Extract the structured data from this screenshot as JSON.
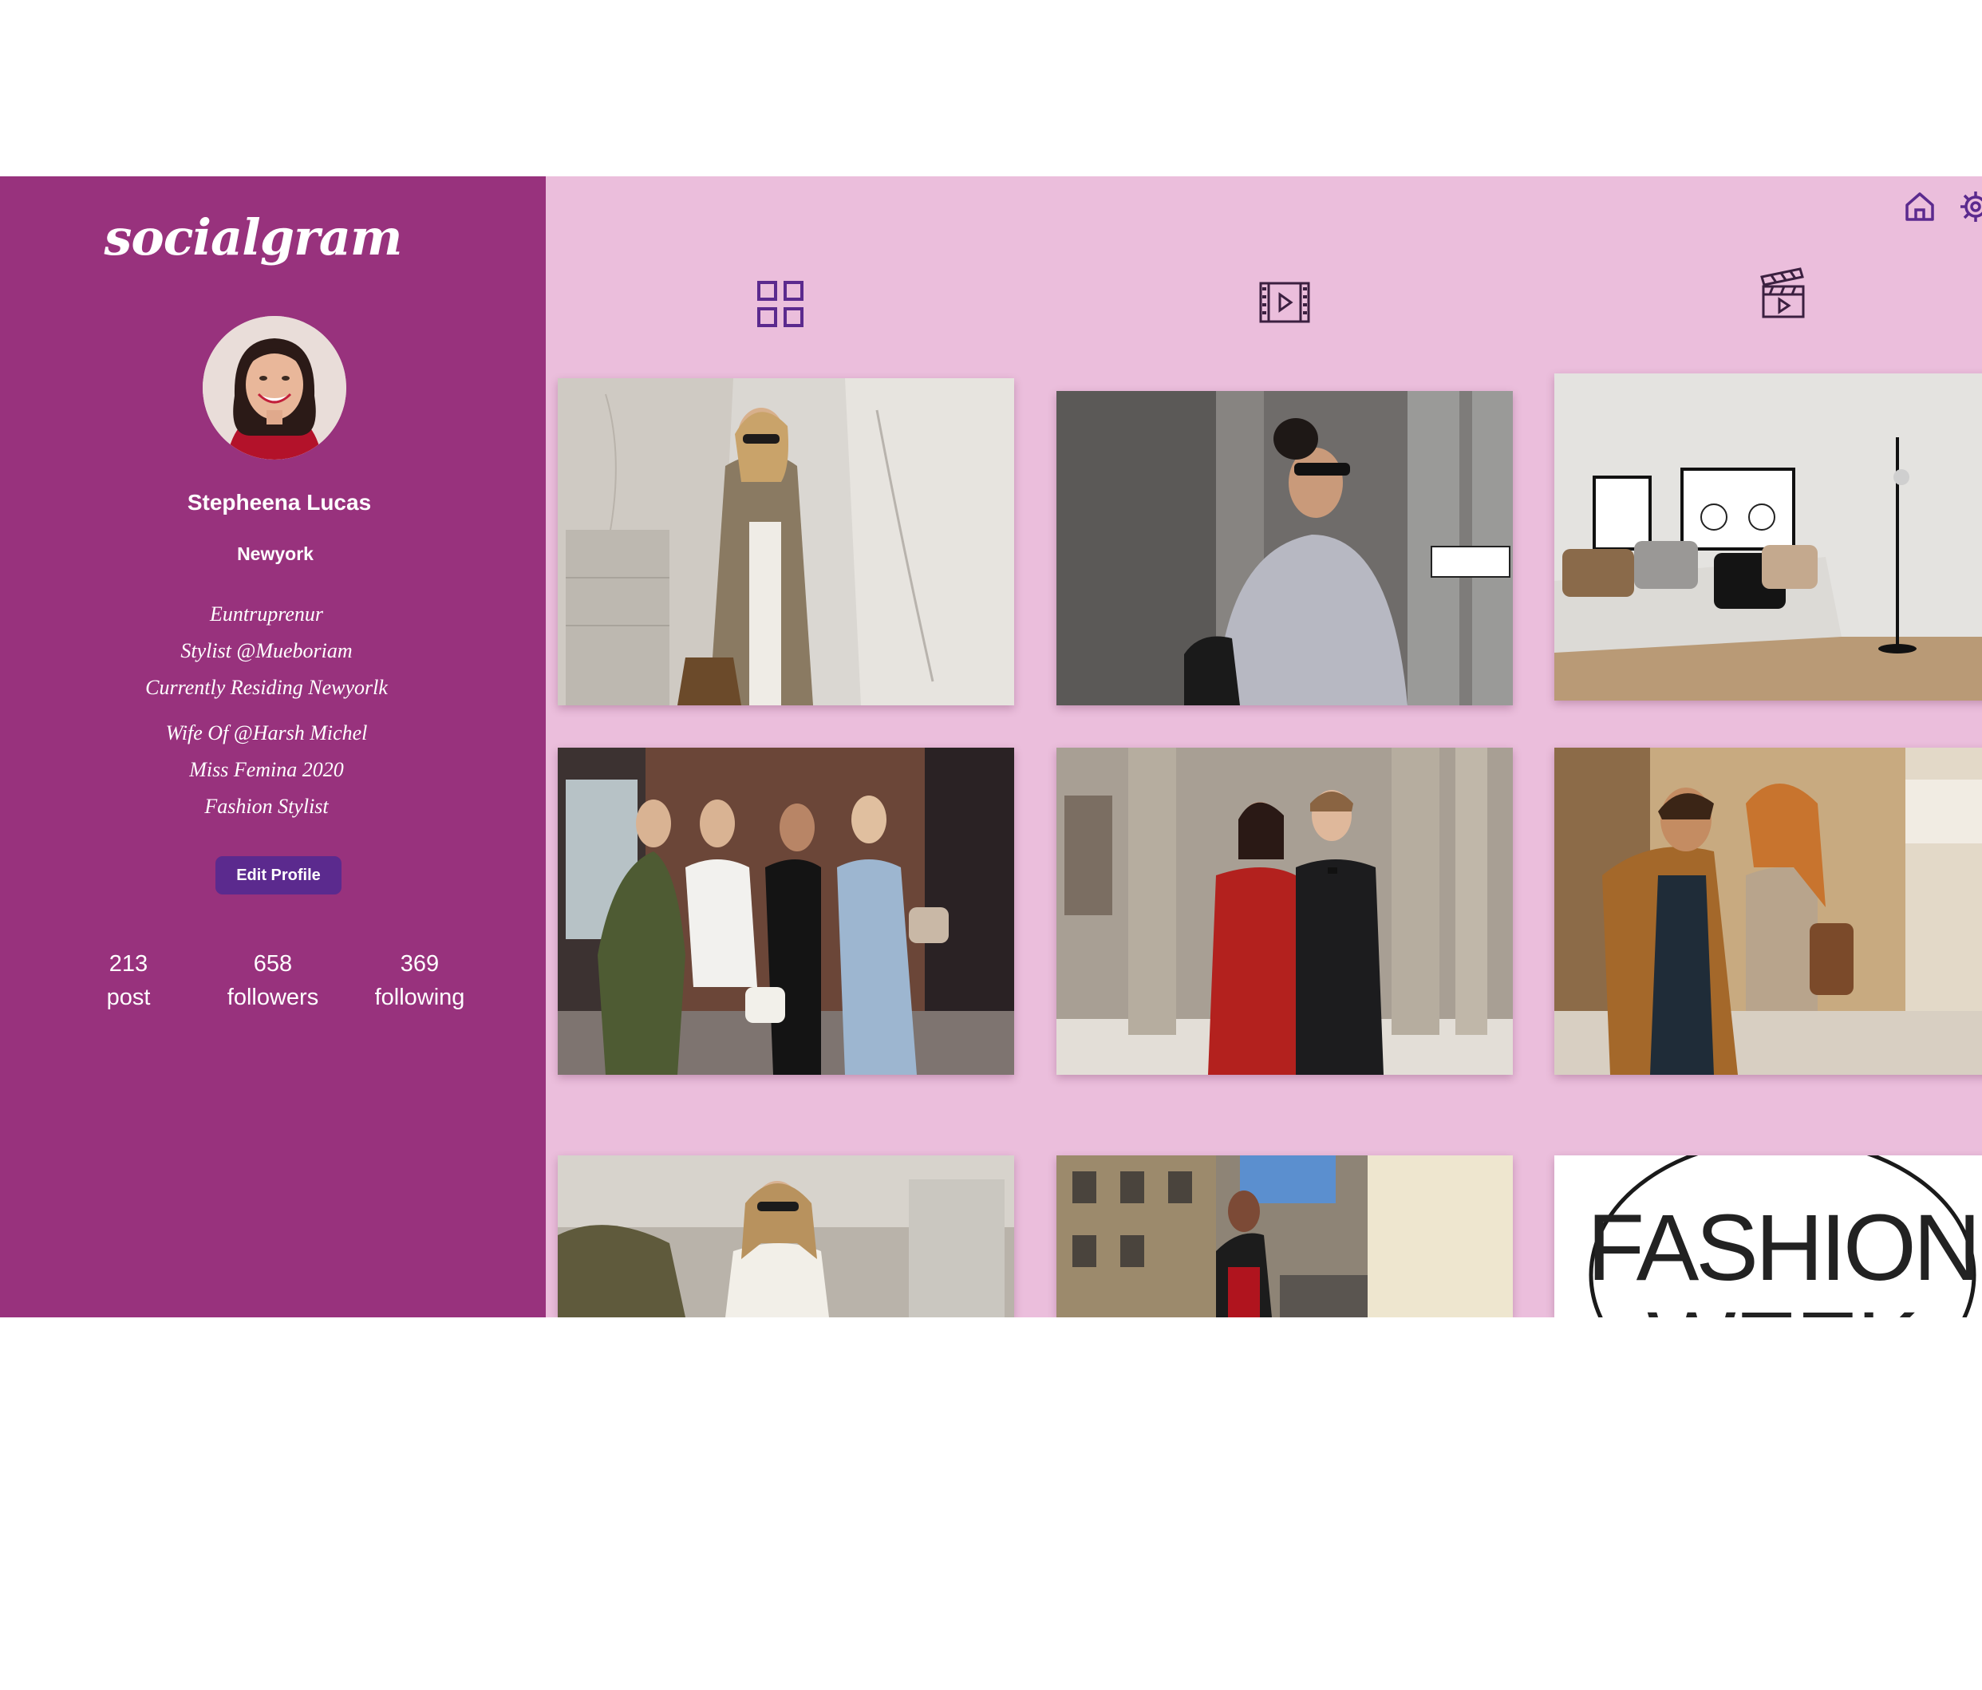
{
  "app": {
    "logo": "socialgram"
  },
  "profile": {
    "name": "Stepheena Lucas",
    "location": "Newyork",
    "bio": [
      "Euntruprenur",
      "Stylist @Mueboriam",
      "Currently Residing Newyorlk",
      "Wife Of @Harsh Michel",
      "Miss Femina 2020",
      "Fashion Stylist"
    ],
    "edit_label": "Edit Profile"
  },
  "stats": [
    {
      "value": "213",
      "label": "post"
    },
    {
      "value": "658",
      "label": "followers"
    },
    {
      "value": "369",
      "label": "following"
    }
  ],
  "icons": {
    "top": [
      "home-icon",
      "gear-icon"
    ],
    "tabs": [
      "grid-icon",
      "video-icon",
      "clapperboard-icon"
    ]
  },
  "posts": [
    {
      "subject": "woman in trench coat mirror selfie"
    },
    {
      "subject": "woman in grey sweatshirt on street"
    },
    {
      "subject": "living room interior with bicycle print"
    },
    {
      "subject": "four women posing on street"
    },
    {
      "subject": "couple in red dress and tuxedo"
    },
    {
      "subject": "couple walking in old town"
    },
    {
      "subject": "woman with sunglasses outdoors"
    },
    {
      "subject": "woman in city street"
    },
    {
      "subject": "fashion week logo",
      "text_line1": "FASHION",
      "text_line2": "WEEK"
    }
  ],
  "colors": {
    "sidebar": "#98327d",
    "main": "#ebbedc",
    "button": "#5b2a8e",
    "icon": "#5b2a8e"
  }
}
